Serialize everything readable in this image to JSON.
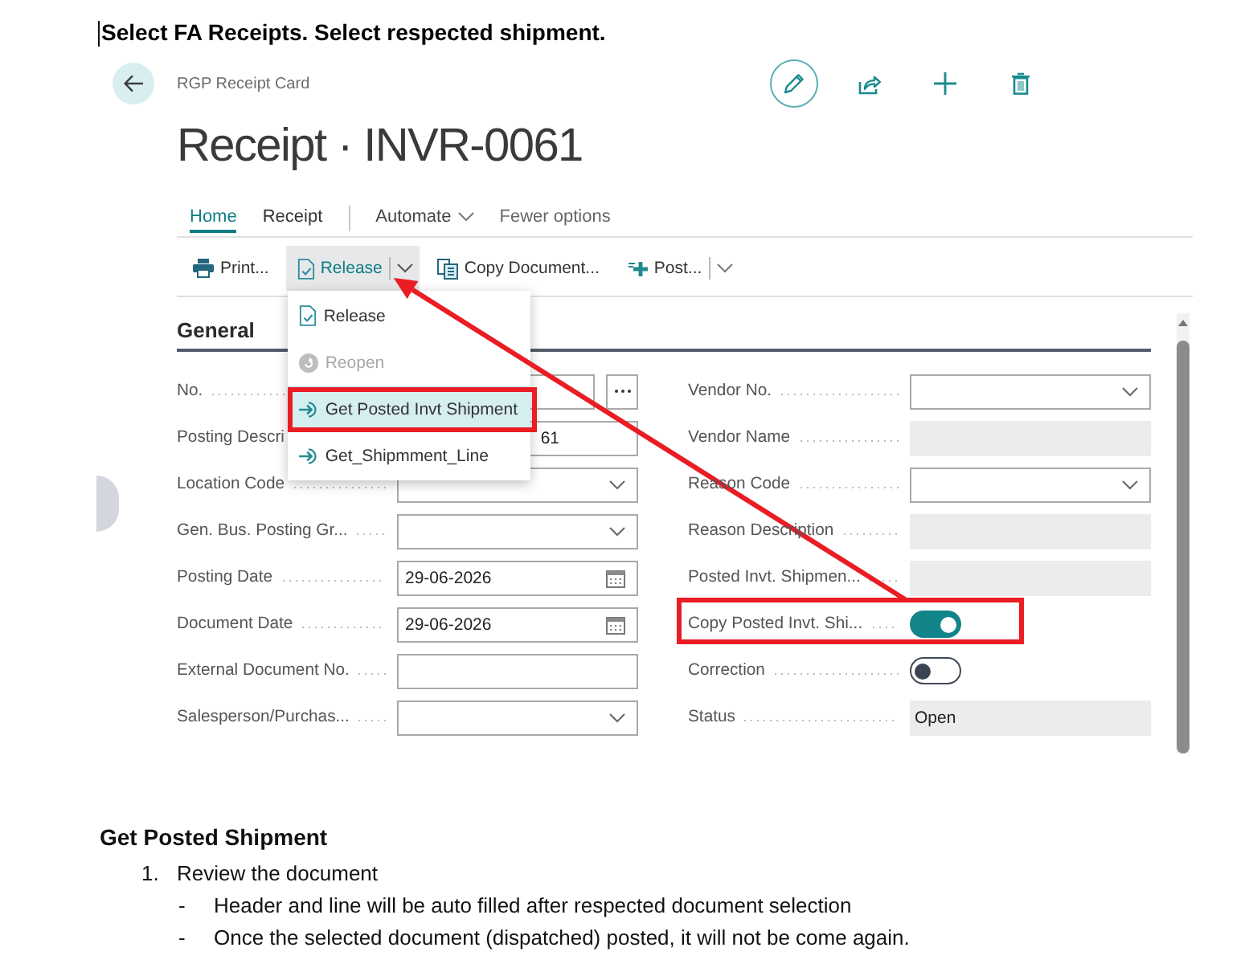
{
  "document": {
    "heading": "Select FA Receipts. Select respected shipment."
  },
  "card": {
    "breadcrumb": "RGP Receipt Card",
    "title": "Receipt · INVR-0061",
    "tabs": [
      {
        "label": "Home",
        "kind": "tab",
        "selected": true
      },
      {
        "label": "Receipt",
        "kind": "tab",
        "selected": false
      },
      {
        "label": "Automate",
        "kind": "menu",
        "selected": false
      },
      {
        "label": "Fewer options",
        "kind": "link",
        "selected": false
      }
    ],
    "toolbar": [
      {
        "label": "Print...",
        "kind": "button"
      },
      {
        "label": "Release",
        "kind": "split",
        "expanded": true,
        "menu": [
          {
            "label": "Release",
            "disabled": false,
            "selected": false,
            "annotated": false
          },
          {
            "label": "Reopen",
            "disabled": true,
            "selected": false,
            "annotated": false
          },
          {
            "label": "Get Posted Invt Shipment",
            "disabled": false,
            "selected": true,
            "annotated": true
          },
          {
            "label": "Get_Shipmment_Line",
            "disabled": false,
            "selected": false,
            "annotated": false
          }
        ]
      },
      {
        "label": "Copy Document...",
        "kind": "button"
      },
      {
        "label": "Post...",
        "kind": "split",
        "expanded": false
      }
    ],
    "section": {
      "title": "General",
      "left_fields": [
        {
          "label": "No.",
          "kind": "lookup"
        },
        {
          "label": "Posting Descri",
          "kind": "text",
          "value": "61"
        },
        {
          "label": "Location Code",
          "kind": "select"
        },
        {
          "label": "Gen. Bus. Posting Gr...",
          "kind": "select"
        },
        {
          "label": "Posting Date",
          "kind": "date",
          "value": "29-06-2026"
        },
        {
          "label": "Document Date",
          "kind": "date",
          "value": "29-06-2026"
        },
        {
          "label": "External Document No.",
          "kind": "text"
        },
        {
          "label": "Salesperson/Purchas...",
          "kind": "select"
        }
      ],
      "right_fields": [
        {
          "label": "Vendor No.",
          "kind": "select",
          "annotated": false
        },
        {
          "label": "Vendor Name",
          "kind": "readonly",
          "annotated": false
        },
        {
          "label": "Reason Code",
          "kind": "select",
          "annotated": false
        },
        {
          "label": "Reason Description",
          "kind": "readonly",
          "annotated": false
        },
        {
          "label": "Posted Invt. Shipmen...",
          "kind": "readonly",
          "annotated": false
        },
        {
          "label": "Copy Posted Invt. Shi...",
          "kind": "toggle",
          "on": true,
          "annotated": true
        },
        {
          "label": "Correction",
          "kind": "toggle",
          "on": false,
          "annotated": false
        },
        {
          "label": "Status",
          "kind": "readonly",
          "value": "Open",
          "annotated": false
        }
      ]
    }
  },
  "notes": {
    "heading": "Get Posted Shipment",
    "steps": [
      {
        "number": "1.",
        "text": "Review the document",
        "points": [
          {
            "marker": "-",
            "text": "Header and line will be auto filled after respected document selection"
          },
          {
            "marker": "-",
            "text": "Once the selected document (dispatched) posted, it will not be come again."
          }
        ]
      }
    ]
  }
}
